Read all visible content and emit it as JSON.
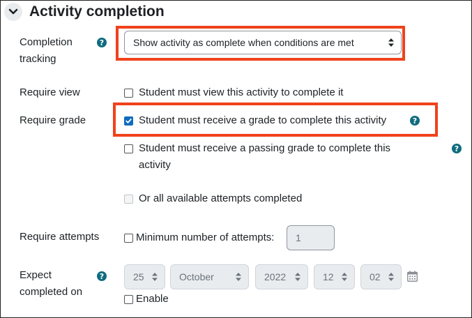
{
  "section": {
    "title": "Activity completion",
    "collapse_icon": "chevron-down-icon"
  },
  "completion_tracking": {
    "label_line1": "Completion",
    "label_line2": "tracking",
    "help_icon": "question-circle-icon",
    "selected": "Show activity as complete when conditions are met"
  },
  "require_view": {
    "label": "Require view",
    "checkbox_label": "Student must view this activity to complete it",
    "checked": false
  },
  "require_grade": {
    "label": "Require grade",
    "checkbox_label": "Student must receive a grade to complete this activity",
    "checked": true
  },
  "passing_grade": {
    "checkbox_label_line1": "Student must receive a passing grade to complete this",
    "checkbox_label_line2": "activity",
    "checked": false
  },
  "all_attempts": {
    "checkbox_label": "Or all available attempts completed",
    "checked": false,
    "disabled": true
  },
  "require_attempts": {
    "label": "Require attempts",
    "checkbox_label": "Minimum number of attempts:",
    "checked": false,
    "value": "1"
  },
  "expect_completed": {
    "label_line1": "Expect",
    "label_line2": "completed on",
    "day": "25",
    "month": "October",
    "year": "2022",
    "hour": "12",
    "minute": "02",
    "calendar_icon": "calendar-icon",
    "enable_label": "Enable",
    "enable_checked": false
  },
  "colors": {
    "highlight": "#f0421c",
    "help": "#0f6c7f",
    "checkbox_checked": "#0f6cbf"
  }
}
